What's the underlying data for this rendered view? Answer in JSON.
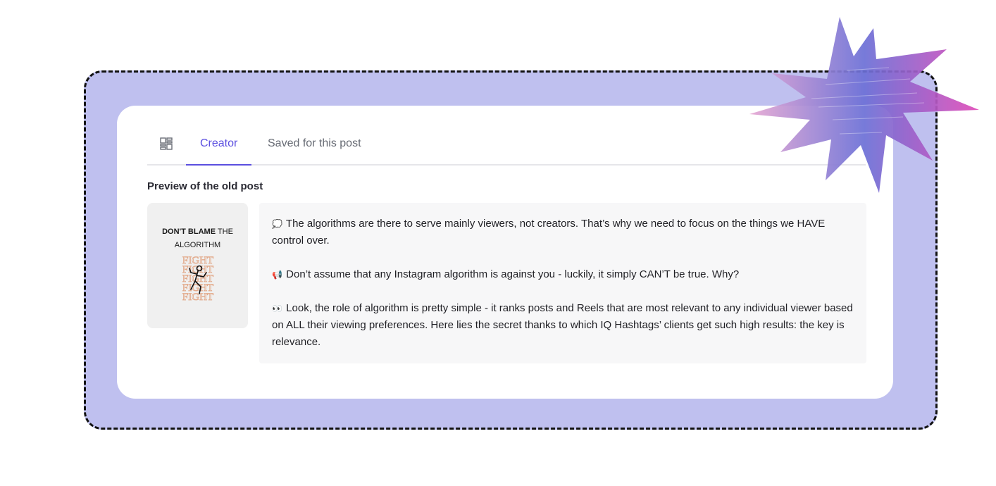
{
  "tabs": [
    {
      "icon": "grid-icon"
    },
    {
      "label": "Creator",
      "active": true
    },
    {
      "label": "Saved for this post",
      "active": false
    }
  ],
  "section_title": "Preview of the old post",
  "thumbnail": {
    "line1_bold": "DON'T BLAME",
    "line1_rest": " THE",
    "line2": "ALGORITHM",
    "art_text": "FIGHT"
  },
  "post": {
    "paragraphs": [
      {
        "icon": "💭",
        "text": "The algorithms are there to serve mainly viewers, not creators. That’s why we need to focus on the things we HAVE control over."
      },
      {
        "icon": "📢",
        "text": "Don’t assume that any Instagram algorithm is against you - luckily, it simply CAN’T be true. Why?"
      },
      {
        "icon": "👀",
        "text": "Look, the role of algorithm is pretty simple - it ranks posts and Reels that are most relevant to any individual viewer based on ALL their viewing preferences. Here lies the secret thanks to which IQ Hashtags’ clients get such high results: the key is relevance."
      }
    ]
  },
  "colors": {
    "accent": "#5b4fe0",
    "frame_bg": "#bfc0ef",
    "starburst_from": "#e6a7d2",
    "starburst_mid": "#6b6fd6",
    "starburst_to": "#e04bb8"
  }
}
